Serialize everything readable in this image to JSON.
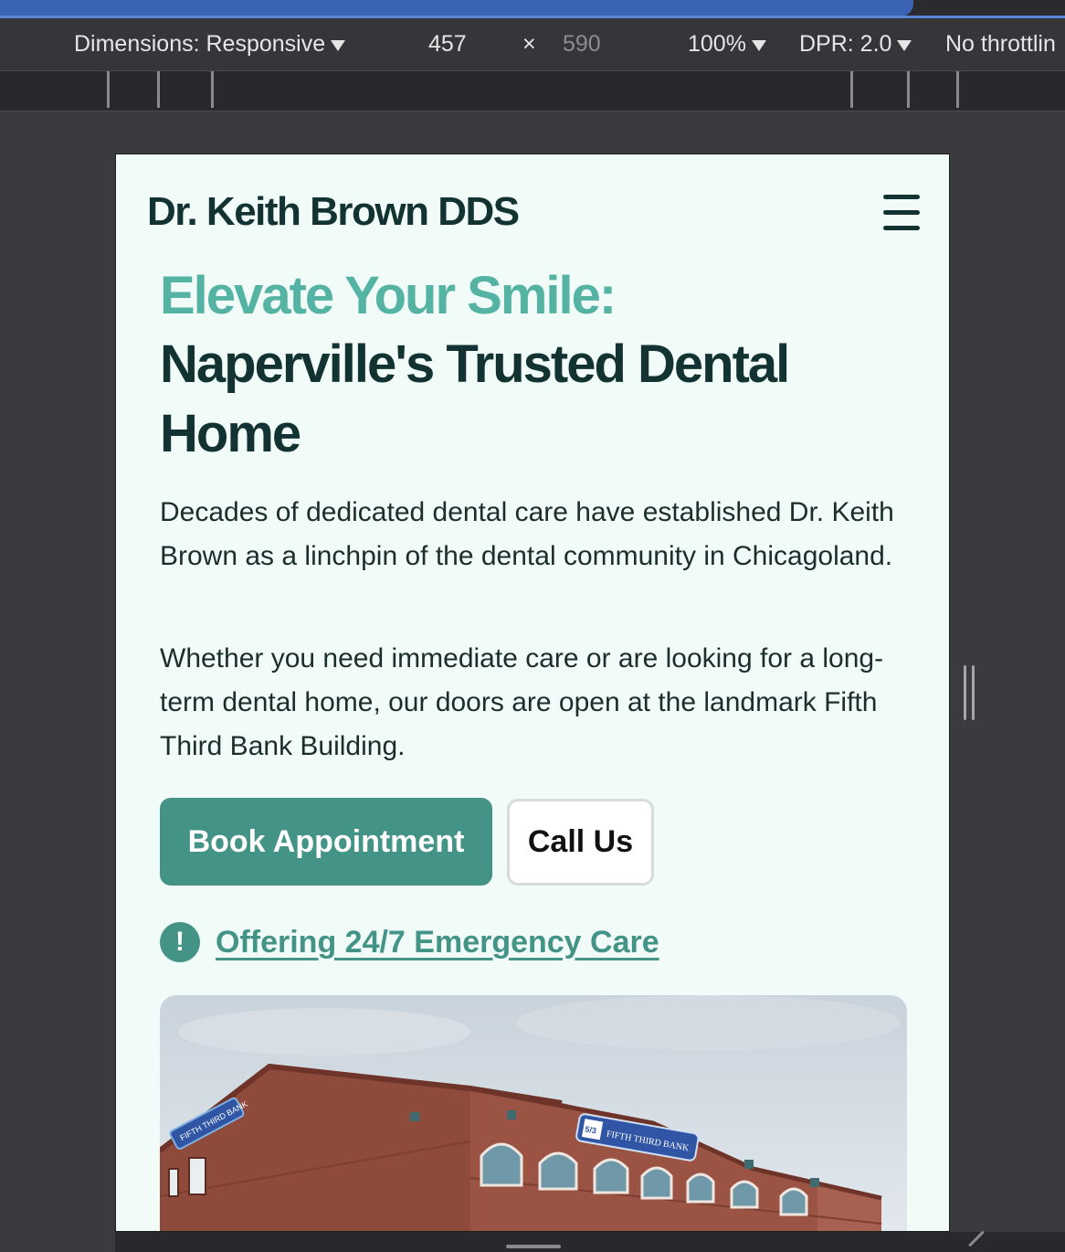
{
  "devtools": {
    "dimensions_label": "Dimensions: Responsive",
    "width": "457",
    "times": "×",
    "height": "590",
    "zoom": "100%",
    "dpr": "DPR: 2.0",
    "throttling": "No throttlin"
  },
  "site": {
    "brand": "Dr. Keith Brown DDS",
    "headline_accent": "Elevate Your Smile:",
    "headline_line1": "Naperville's Trusted Dental",
    "headline_line2": "Home",
    "intro_paragraph": "Decades of dedicated dental care have established Dr. Keith Brown as a linchpin of the dental community in Chicagoland.",
    "second_paragraph": "Whether you need immediate care or are looking for a long-term dental home, our doors are open at the landmark Fifth Third Bank Building.",
    "book_button": "Book Appointment",
    "call_button": "Call Us",
    "alert_glyph": "!",
    "emergency_link": "Offering 24/7 Emergency Care",
    "photo": {
      "sign_left": "FIFTH THIRD BANK",
      "sign_right": "FIFTH THIRD BANK",
      "logo_mark": "5/3"
    }
  },
  "colors": {
    "accent": "#54b3a2",
    "primary_button": "#439486",
    "heading": "#123331",
    "page_background": "#f1fbf8"
  }
}
